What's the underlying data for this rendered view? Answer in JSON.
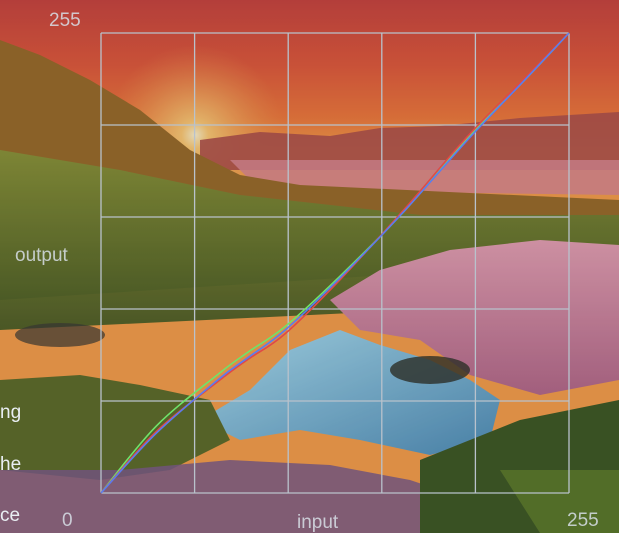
{
  "curves_panel": {
    "y_max_label": "255",
    "y_axis_label": "output",
    "x_min_label": "0",
    "x_axis_label": "input",
    "x_max_label": "255",
    "grid_divisions": 5,
    "range": [
      0,
      255
    ]
  },
  "captions": [
    "ng",
    "he",
    "ce"
  ],
  "curves": [
    {
      "channel": "green",
      "color": "#6fe36a",
      "points": [
        [
          0,
          0
        ],
        [
          30,
          37
        ],
        [
          64,
          66
        ],
        [
          80,
          78
        ],
        [
          100,
          92
        ],
        [
          130,
          120
        ],
        [
          165,
          156
        ],
        [
          200,
          197
        ],
        [
          230,
          228
        ],
        [
          255,
          255
        ]
      ]
    },
    {
      "channel": "red",
      "color": "#e04848",
      "points": [
        [
          0,
          0
        ],
        [
          30,
          34
        ],
        [
          64,
          62
        ],
        [
          80,
          74
        ],
        [
          100,
          88
        ],
        [
          130,
          118
        ],
        [
          165,
          157
        ],
        [
          200,
          198
        ],
        [
          230,
          229
        ],
        [
          255,
          255
        ]
      ]
    },
    {
      "channel": "blue",
      "color": "#5a7cf0",
      "points": [
        [
          0,
          0
        ],
        [
          30,
          33
        ],
        [
          64,
          63
        ],
        [
          80,
          75
        ],
        [
          100,
          90
        ],
        [
          130,
          119
        ],
        [
          165,
          156
        ],
        [
          200,
          196
        ],
        [
          230,
          228
        ],
        [
          255,
          255
        ]
      ]
    }
  ],
  "colors": {
    "grid": "#b9c2cc",
    "label": "#d7dee6"
  }
}
